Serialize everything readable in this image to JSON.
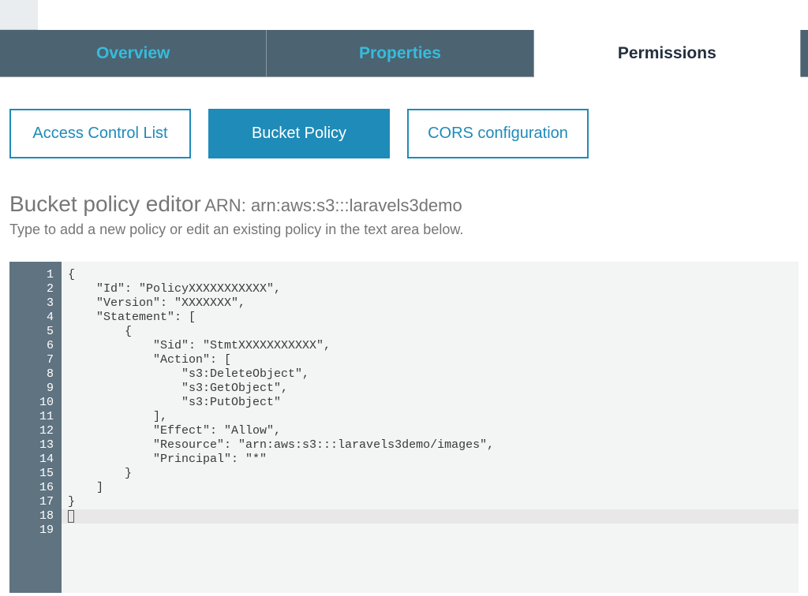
{
  "main_tabs": {
    "overview": "Overview",
    "properties": "Properties",
    "permissions": "Permissions",
    "active": "permissions"
  },
  "sub_tabs": {
    "acl": "Access Control List",
    "bucket_policy": "Bucket Policy",
    "cors": "CORS configuration",
    "active": "bucket_policy"
  },
  "editor_header": {
    "title": "Bucket policy editor",
    "arn_label": "ARN:",
    "arn_value": "arn:aws:s3:::laravels3demo",
    "hint": "Type to add a new policy or edit an existing policy in the text area below."
  },
  "code": {
    "line_count": 19,
    "current_line": 18,
    "lines": [
      "{",
      "    \"Id\": \"PolicyXXXXXXXXXXX\",",
      "    \"Version\": \"XXXXXXX\",",
      "    \"Statement\": [",
      "        {",
      "            \"Sid\": \"StmtXXXXXXXXXXX\",",
      "            \"Action\": [",
      "                \"s3:DeleteObject\",",
      "                \"s3:GetObject\",",
      "                \"s3:PutObject\"",
      "            ],",
      "            \"Effect\": \"Allow\",",
      "            \"Resource\": \"arn:aws:s3:::laravels3demo/images\",",
      "            \"Principal\": \"*\"",
      "        }",
      "    ]",
      "}",
      "",
      ""
    ]
  }
}
